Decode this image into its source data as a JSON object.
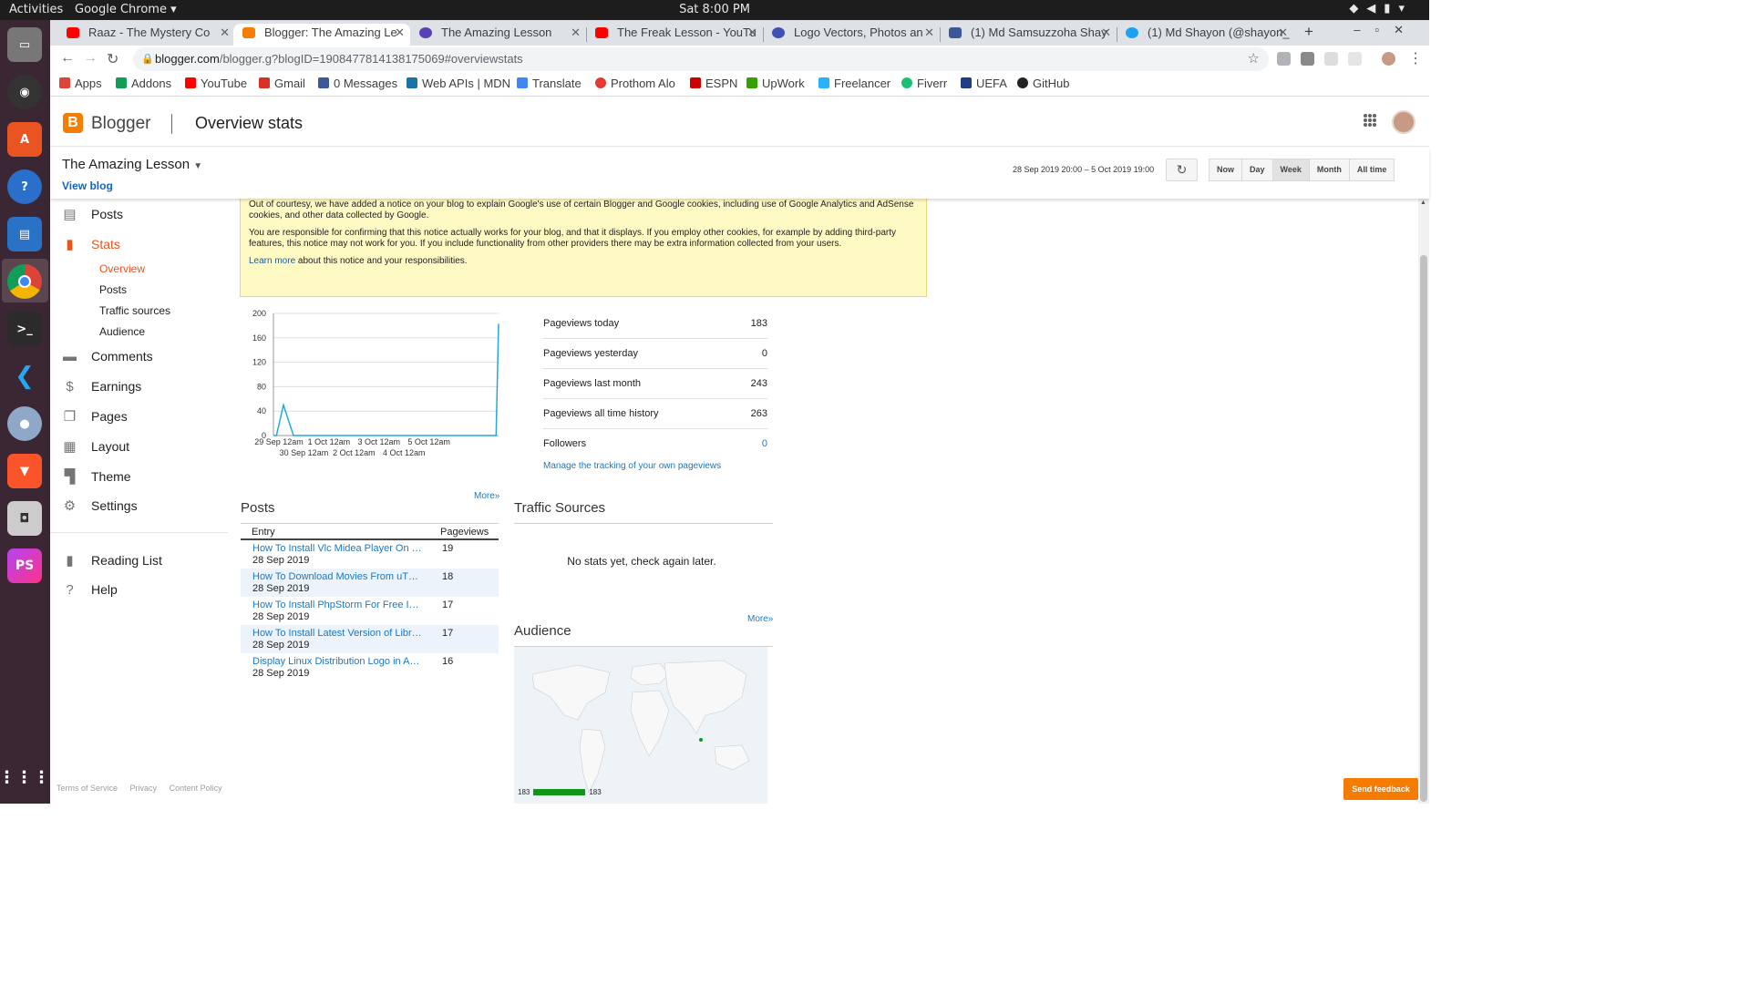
{
  "system": {
    "activities": "Activities",
    "app_menu": "Google Chrome ▾",
    "clock": "Sat  8:00 PM"
  },
  "tabs": [
    {
      "title": "Raaz - The Mystery Co",
      "color": "#ff0000"
    },
    {
      "title": "Blogger: The Amazing Le",
      "color": "#f57d00"
    },
    {
      "title": "The Amazing Lesson",
      "color": "#5b3fb8"
    },
    {
      "title": "The Freak Lesson - YouTu",
      "color": "#ff0000"
    },
    {
      "title": "Logo Vectors, Photos an",
      "color": "#3f51b5"
    },
    {
      "title": "(1) Md Samsuzzoha Shay",
      "color": "#3b5998"
    },
    {
      "title": "(1) Md Shayon (@shayon_",
      "color": "#1da1f2"
    }
  ],
  "address": {
    "host": "blogger.com",
    "path": "/blogger.g?blogID=1908477814138175069#overviewstats"
  },
  "bookmarks": [
    {
      "label": "Apps",
      "color": "#db4437"
    },
    {
      "label": "Addons",
      "color": "#0f9d58"
    },
    {
      "label": "YouTube",
      "color": "#ff0000"
    },
    {
      "label": "Gmail",
      "color": "#d93025"
    },
    {
      "label": "0 Messages",
      "color": "#3b5998"
    },
    {
      "label": "Web APIs | MDN",
      "color": "#1a73a8"
    },
    {
      "label": "Translate",
      "color": "#4285f4"
    },
    {
      "label": "Prothom Alo",
      "color": "#e53935"
    },
    {
      "label": "ESPN",
      "color": "#cc0000"
    },
    {
      "label": "UpWork",
      "color": "#37a000"
    },
    {
      "label": "Freelancer",
      "color": "#29b2fe"
    },
    {
      "label": "Fiverr",
      "color": "#1dbf73"
    },
    {
      "label": "UEFA",
      "color": "#1f3c88"
    },
    {
      "label": "GitHub",
      "color": "#222222"
    }
  ],
  "header": {
    "logo_letter": "B",
    "app_name": "Blogger",
    "page_title": "Overview stats"
  },
  "blog": {
    "name": "The Amazing Lesson",
    "view_blog": "View blog"
  },
  "range": {
    "text": "28 Sep 2019 20:00 – 5 Oct 2019 19:00",
    "periods": [
      "Now",
      "Day",
      "Week",
      "Month",
      "All time"
    ],
    "selected": "Week"
  },
  "sidebar": {
    "items": [
      {
        "label": "Posts",
        "icon": "posts-icon",
        "glyph": "▤"
      },
      {
        "label": "Stats",
        "icon": "stats-icon",
        "glyph": "▮"
      },
      {
        "label": "Comments",
        "icon": "comments-icon",
        "glyph": "▬"
      },
      {
        "label": "Earnings",
        "icon": "dollar-icon",
        "glyph": "$"
      },
      {
        "label": "Pages",
        "icon": "pages-icon",
        "glyph": "❐"
      },
      {
        "label": "Layout",
        "icon": "layout-icon",
        "glyph": "▦"
      },
      {
        "label": "Theme",
        "icon": "paint-roller-icon",
        "glyph": "▜"
      },
      {
        "label": "Settings",
        "icon": "gear-icon",
        "glyph": "⚙"
      },
      {
        "label": "Reading List",
        "icon": "bookmark-icon",
        "glyph": "▮"
      },
      {
        "label": "Help",
        "icon": "help-icon",
        "glyph": "?"
      }
    ],
    "stats_sub": [
      "Overview",
      "Posts",
      "Traffic sources",
      "Audience"
    ],
    "footer": [
      "Terms of Service",
      "Privacy",
      "Content Policy"
    ]
  },
  "notice": {
    "p1": "Out of courtesy, we have added a notice on your blog to explain Google's use of certain Blogger and Google cookies, including use of Google Analytics and AdSense cookies, and other data collected by Google.",
    "p2": "You are responsible for confirming that this notice actually works for your blog, and that it displays. If you employ other cookies, for example by adding third-party features, this notice may not work for you. If you include functionality from other providers there may be extra information collected from your users.",
    "link": "Learn more",
    "tail": " about this notice and your responsibilities."
  },
  "chart_data": {
    "type": "line",
    "color": "#25a9d4",
    "ylim": [
      0,
      200
    ],
    "yticks": [
      "200",
      "160",
      "120",
      "80",
      "40",
      "0"
    ],
    "xticks_top": [
      "29 Sep 12am",
      "1 Oct 12am",
      "3 Oct 12am",
      "5 Oct 12am"
    ],
    "xticks_bottom": [
      "30 Sep 12am",
      "2 Oct 12am",
      "4 Oct 12am"
    ],
    "points": [
      [
        0,
        0
      ],
      [
        0.12,
        0
      ],
      [
        0.4,
        50
      ],
      [
        0.8,
        0
      ],
      [
        1,
        0
      ],
      [
        2,
        0
      ],
      [
        3,
        0
      ],
      [
        4,
        0
      ],
      [
        5,
        0
      ],
      [
        6,
        0
      ],
      [
        7,
        0
      ],
      [
        8,
        0
      ],
      [
        8.9,
        0
      ],
      [
        9,
        183
      ]
    ]
  },
  "stats": [
    {
      "label": "Pageviews today",
      "value": "183"
    },
    {
      "label": "Pageviews yesterday",
      "value": "0"
    },
    {
      "label": "Pageviews last month",
      "value": "243"
    },
    {
      "label": "Pageviews all time history",
      "value": "263"
    },
    {
      "label": "Followers",
      "value": "0"
    }
  ],
  "manage_link": "Manage the tracking of your own pageviews",
  "more": "More»",
  "posts": {
    "heading": "Posts",
    "col_entry": "Entry",
    "col_views": "Pageviews",
    "rows": [
      {
        "title": "How To Install Vlc Midea Player On …",
        "date": "28 Sep 2019",
        "views": "19"
      },
      {
        "title": "How To Download Movies From uT…",
        "date": "28 Sep 2019",
        "views": "18"
      },
      {
        "title": "How To Install PhpStorm For Free I…",
        "date": "28 Sep 2019",
        "views": "17"
      },
      {
        "title": "How To Install Latest Version of Libr…",
        "date": "28 Sep 2019",
        "views": "17"
      },
      {
        "title": "Display Linux Distribution Logo in A…",
        "date": "28 Sep 2019",
        "views": "16"
      }
    ]
  },
  "traffic": {
    "heading": "Traffic Sources",
    "empty": "No stats yet, check again later."
  },
  "audience": {
    "heading": "Audience",
    "legend_min": "183",
    "legend_max": "183"
  },
  "feedback": "Send feedback"
}
